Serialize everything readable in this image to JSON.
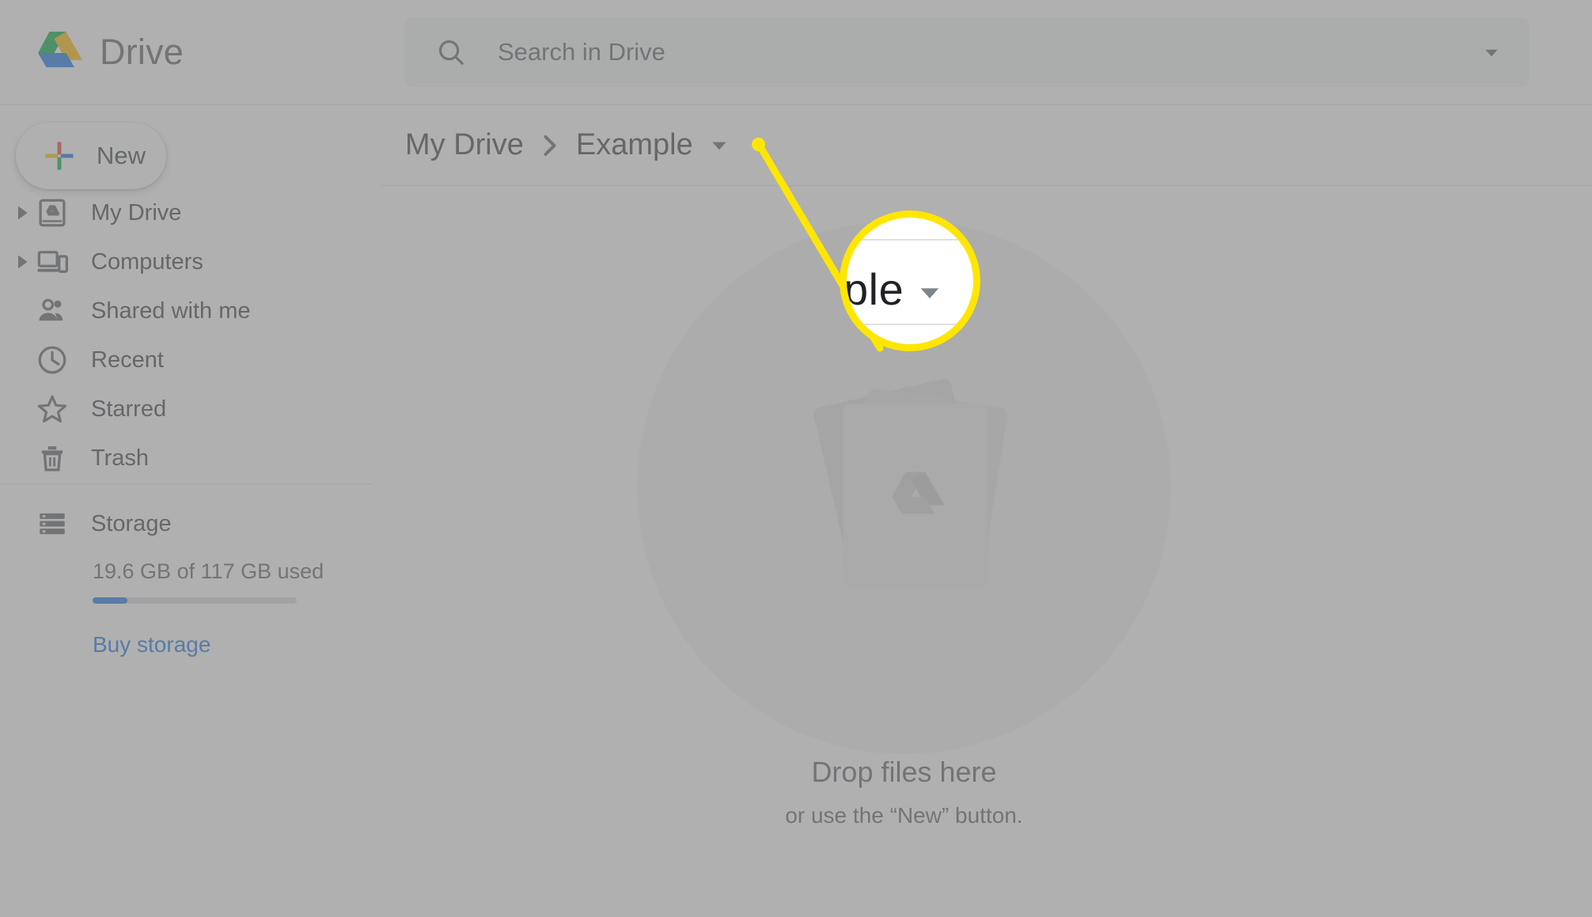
{
  "app": {
    "brand_title": "Drive",
    "logo_icon": "drive-logo"
  },
  "search": {
    "placeholder": "Search in Drive",
    "value": "",
    "icon": "search-icon",
    "options_icon": "chevron-down-icon"
  },
  "sidebar": {
    "new_button": {
      "label": "New",
      "icon": "plus-icon"
    },
    "items": [
      {
        "label": "My Drive",
        "icon": "my-drive-icon",
        "expandable": true
      },
      {
        "label": "Computers",
        "icon": "computers-icon",
        "expandable": true
      },
      {
        "label": "Shared with me",
        "icon": "shared-with-me-icon",
        "expandable": false
      },
      {
        "label": "Recent",
        "icon": "clock-icon",
        "expandable": false
      },
      {
        "label": "Starred",
        "icon": "star-icon",
        "expandable": false
      },
      {
        "label": "Trash",
        "icon": "trash-icon",
        "expandable": false
      }
    ],
    "storage": {
      "label": "Storage",
      "icon": "storage-icon",
      "used_text": "19.6 GB of 117 GB used",
      "percent_used": 17,
      "buy_link": "Buy storage"
    }
  },
  "main": {
    "breadcrumb": {
      "root": "My Drive",
      "separator_icon": "chevron-right-icon",
      "current": "Example",
      "menu_icon": "dropdown-triangle-icon"
    },
    "empty_state": {
      "title": "Drop files here",
      "subtitle": "or use the “New” button.",
      "illustration_icon": "stacked-files-drive-icon"
    }
  },
  "callout": {
    "color": "#ffe600",
    "magnifier_text": "ple",
    "magnifier_caret_icon": "dropdown-triangle-icon",
    "dot_icon": "callout-dot",
    "line_icon": "callout-line"
  },
  "colors": {
    "accent_blue": "#1a73e8",
    "text_primary": "#3c4043",
    "text_secondary": "#5f6368",
    "highlight_yellow": "#ffe600",
    "drive_blue": "#1a73e8",
    "drive_green": "#00ac47",
    "drive_yellow": "#ffba00",
    "drive_red": "#ea4335"
  }
}
